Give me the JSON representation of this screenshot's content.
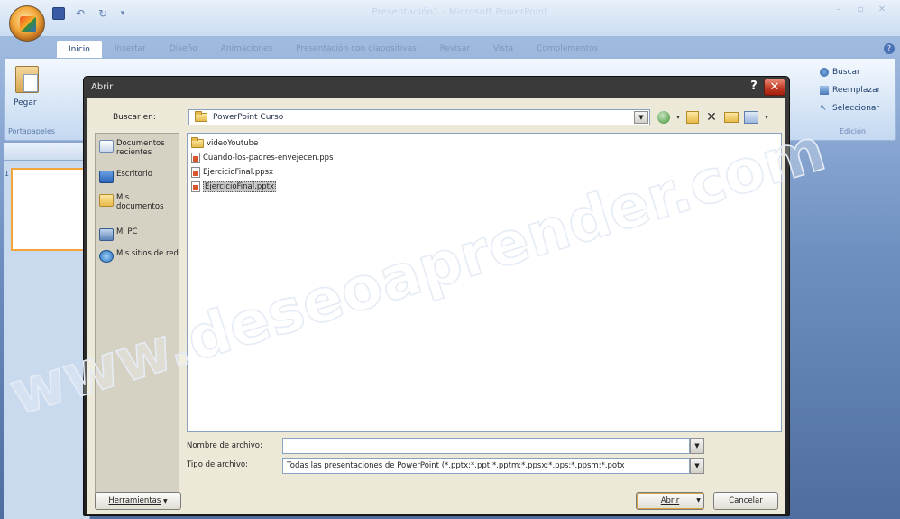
{
  "app": {
    "window_title": "Presentación1 - Microsoft PowerPoint",
    "ribbon_tabs": [
      "Inicio",
      "Insertar",
      "Diseño",
      "Animaciones",
      "Presentación con diapositivas",
      "Revisar",
      "Vista",
      "Complementos"
    ],
    "clipboard": {
      "paste_label": "Pegar",
      "group_label": "Portapapeles"
    },
    "editing": {
      "find": "Buscar",
      "replace": "Reemplazar",
      "select": "Seleccionar",
      "group_label": "Edición"
    },
    "slide_number": "1"
  },
  "dialog": {
    "title": "Abrir",
    "look_in_label": "Buscar en:",
    "look_in_value": "PowerPoint Curso",
    "places": [
      {
        "label": "Documentos recientes"
      },
      {
        "label": "Escritorio"
      },
      {
        "label": "Mis documentos"
      },
      {
        "label": "Mi PC"
      },
      {
        "label": "Mis sitios de red"
      }
    ],
    "files": [
      {
        "name": "videoYoutube",
        "type": "folder"
      },
      {
        "name": "Cuando-los-padres-envejecen.pps",
        "type": "ppt"
      },
      {
        "name": "EjercicioFinal.ppsx",
        "type": "ppt"
      },
      {
        "name": "EjercicioFinal.pptx",
        "type": "ppt",
        "selected": true
      }
    ],
    "file_name_label": "Nombre de archivo:",
    "file_name_value": "",
    "file_type_label": "Tipo de archivo:",
    "file_type_value": "Todas las presentaciones de PowerPoint (*.pptx;*.ppt;*.pptm;*.ppsx;*.pps;*.ppsm;*.potx",
    "tools_label": "Herramientas",
    "open_label": "Abrir",
    "cancel_label": "Cancelar"
  },
  "watermark": "www.deseoaprender.com",
  "colors": {
    "dialog_frame": "#2a2a2a",
    "close_button": "#c23a24",
    "watermark": "#dfe6f2"
  }
}
